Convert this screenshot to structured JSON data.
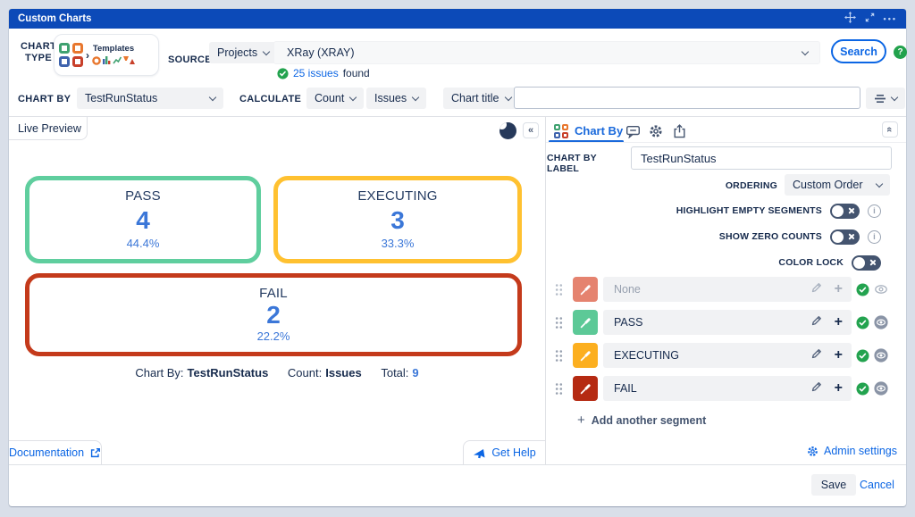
{
  "titlebar": {
    "title": "Custom Charts",
    "icons": [
      "move-icon",
      "fullscreen-icon",
      "more-icon"
    ]
  },
  "toolbar": {
    "chart_type_label": "CHART TYPE",
    "templates_label": "Templates",
    "source_label": "SOURCE",
    "projects_dropdown": "Projects",
    "source_value": "XRay (XRAY)",
    "issues_found": {
      "count_link": "25 issues",
      "suffix": "found"
    },
    "search_button": "Search"
  },
  "controls": {
    "chart_by_label": "CHART BY",
    "chart_by_value": "TestRunStatus",
    "calculate_label": "CALCULATE",
    "calculate_primary": "Count",
    "calculate_secondary": "Issues",
    "chart_title_dropdown": "Chart title",
    "chart_title_value": ""
  },
  "preview": {
    "tab": "Live Preview",
    "footer_caption": {
      "chart_by_key": "Chart By:",
      "chart_by_value": "TestRunStatus",
      "count_key": "Count:",
      "count_value": "Issues",
      "total_key": "Total:",
      "total_value": "9"
    },
    "documentation_link": "Documentation",
    "get_help_link": "Get Help"
  },
  "chart_data": {
    "type": "segment-tiles",
    "title": "",
    "categories": [
      "PASS",
      "EXECUTING",
      "FAIL"
    ],
    "values": [
      4,
      3,
      2
    ],
    "percentages": [
      "44.4%",
      "33.3%",
      "22.2%"
    ],
    "total": 9,
    "tiles": [
      {
        "label": "PASS",
        "value": "4",
        "percent": "44.4%",
        "color": "#5FCE9E"
      },
      {
        "label": "EXECUTING",
        "value": "3",
        "percent": "33.3%",
        "color": "#FFC130"
      },
      {
        "label": "FAIL",
        "value": "2",
        "percent": "22.2%",
        "color": "#C43A1B"
      }
    ]
  },
  "panel": {
    "tab_chart_by": "Chart By",
    "tab_icons": [
      "chart-grid-icon",
      "comment-bubble-icon",
      "gear-icon",
      "share-icon"
    ],
    "chart_by_label": {
      "label": "CHART BY LABEL",
      "value": "TestRunStatus"
    },
    "ordering": {
      "label": "ORDERING",
      "value": "Custom Order"
    },
    "toggles": [
      {
        "label": "HIGHLIGHT EMPTY SEGMENTS",
        "state": "off",
        "has_info": true
      },
      {
        "label": "SHOW ZERO COUNTS",
        "state": "off",
        "has_info": true
      },
      {
        "label": "COLOR LOCK",
        "state": "off",
        "has_info": false
      }
    ],
    "segments": [
      {
        "label": "None",
        "color": "#E5836F",
        "muted": true
      },
      {
        "label": "PASS",
        "color": "#5CC997",
        "muted": false
      },
      {
        "label": "EXECUTING",
        "color": "#FCAF1F",
        "muted": false
      },
      {
        "label": "FAIL",
        "color": "#B52A12",
        "muted": false
      }
    ],
    "add_segment": "Add another segment",
    "admin_settings": "Admin settings"
  },
  "footer": {
    "save": "Save",
    "cancel": "Cancel"
  }
}
